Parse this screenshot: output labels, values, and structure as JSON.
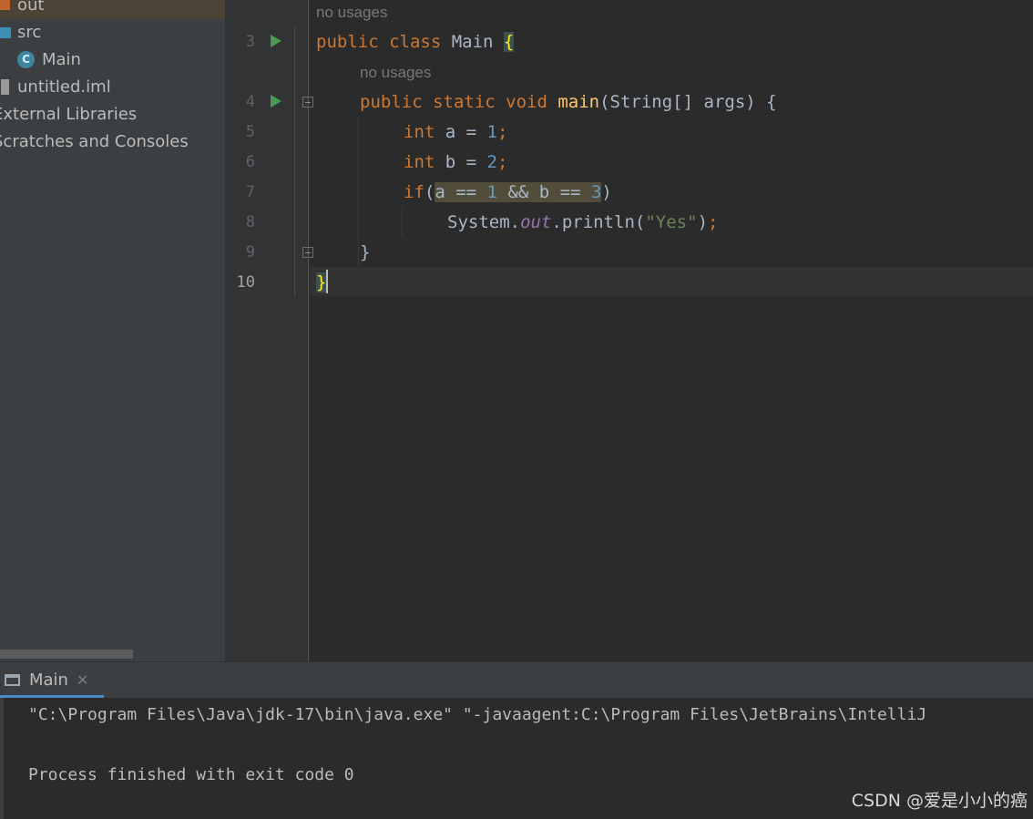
{
  "sidebar": {
    "items": [
      {
        "label": "out"
      },
      {
        "label": "src"
      },
      {
        "label": "Main"
      },
      {
        "label": "untitled.iml"
      },
      {
        "label": "External Libraries"
      },
      {
        "label": "Scratches and Consoles"
      }
    ]
  },
  "editor": {
    "hints": [
      "no usages",
      "no usages"
    ],
    "line_numbers": [
      "3",
      "4",
      "5",
      "6",
      "7",
      "8",
      "9",
      "10"
    ],
    "lines": [
      {
        "ln": "3",
        "text": "public class Main {"
      },
      {
        "ln": "4",
        "text": "public static void main(String[] args) {"
      },
      {
        "ln": "5",
        "text": "int a = 1;"
      },
      {
        "ln": "6",
        "text": "int b = 2;"
      },
      {
        "ln": "7",
        "text": "if(a == 1 && b == 3)"
      },
      {
        "ln": "8",
        "text": "System.out.println(\"Yes\");"
      },
      {
        "ln": "9",
        "text": "}"
      },
      {
        "ln": "10",
        "text": "}"
      }
    ]
  },
  "run_panel": {
    "tab_label": "Main",
    "console": [
      "\"C:\\Program Files\\Java\\jdk-17\\bin\\java.exe\" \"-javaagent:C:\\Program Files\\JetBrains\\IntelliJ",
      "",
      "Process finished with exit code 0"
    ]
  },
  "watermark": "CSDN @爱是小小的癌",
  "colors": {
    "keyword": "#cc7832",
    "number": "#6897bb",
    "string": "#6a8759",
    "method": "#ffc66d",
    "field": "#9876aa",
    "run_icon": "#499c54"
  },
  "icons": [
    "folder-icon",
    "java-class-icon",
    "module-file-icon",
    "run-gutter-icon",
    "fold-icon",
    "console-icon",
    "close-icon"
  ]
}
